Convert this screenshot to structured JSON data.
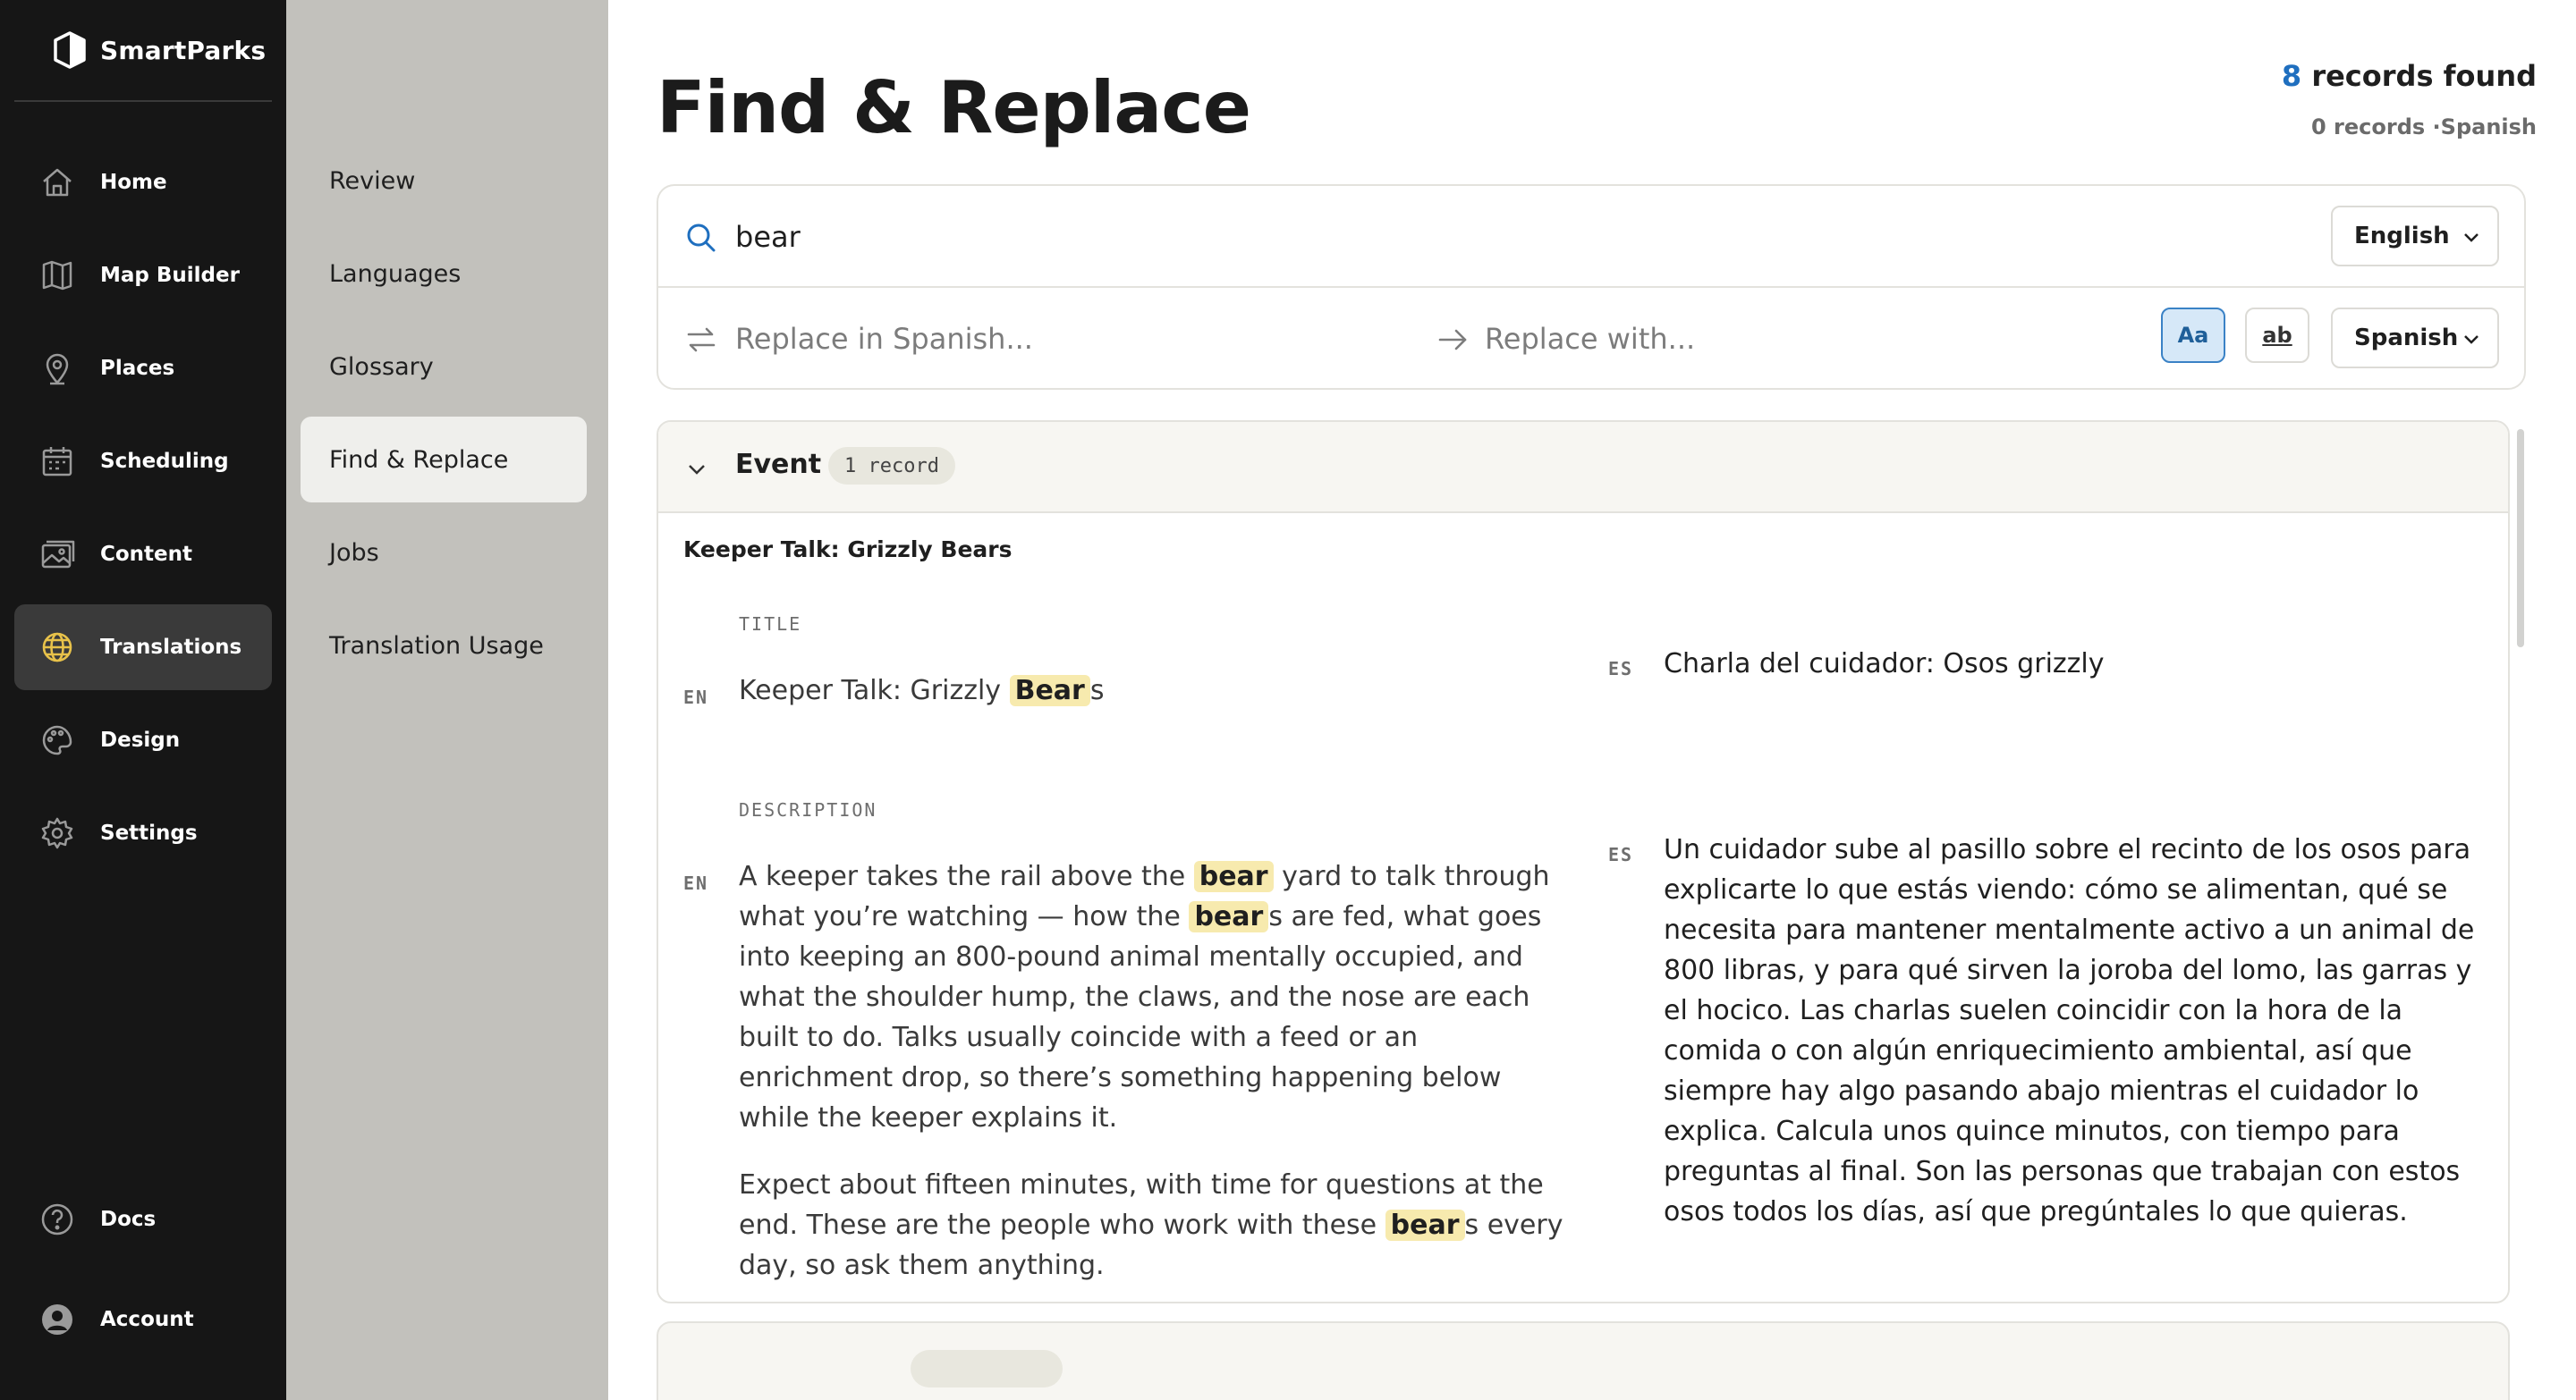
{
  "brand": {
    "name": "SmartParks"
  },
  "sidebar": {
    "items": [
      {
        "label": "Home",
        "icon": "home-icon"
      },
      {
        "label": "Map Builder",
        "icon": "map-icon"
      },
      {
        "label": "Places",
        "icon": "pin-icon"
      },
      {
        "label": "Scheduling",
        "icon": "calendar-icon"
      },
      {
        "label": "Content",
        "icon": "image-icon"
      },
      {
        "label": "Translations",
        "icon": "globe-icon",
        "active": true
      },
      {
        "label": "Design",
        "icon": "palette-icon"
      },
      {
        "label": "Settings",
        "icon": "gear-icon"
      }
    ],
    "bottom": [
      {
        "label": "Docs",
        "icon": "help-icon"
      },
      {
        "label": "Account",
        "icon": "user-icon"
      }
    ]
  },
  "subnav": {
    "items": [
      {
        "label": "Review"
      },
      {
        "label": "Languages"
      },
      {
        "label": "Glossary"
      },
      {
        "label": "Find & Replace",
        "active": true
      },
      {
        "label": "Jobs"
      },
      {
        "label": "Translation Usage"
      }
    ]
  },
  "page": {
    "title": "Find & Replace",
    "records_count": "8",
    "records_label": " records found",
    "records_sub": "0 records ·Spanish"
  },
  "search": {
    "value": "bear",
    "source_language": "English",
    "replace_placeholder": "Replace in Spanish...",
    "with_placeholder": "Replace with...",
    "match_case_label": "Aa",
    "whole_word_label": "ab",
    "target_language": "Spanish"
  },
  "results": [
    {
      "group": "Event",
      "badge": "1 record",
      "record_title": "Keeper Talk: Grizzly Bears",
      "title_label": "TITLE",
      "description_label": "DESCRIPTION",
      "en_tag": "EN",
      "es_tag": "ES",
      "title_en_pre": "Keeper Talk: Grizzly ",
      "title_en_match": "Bear",
      "title_en_post": "s",
      "title_es": "Charla del cuidador: Osos grizzly",
      "desc_en_1a": "A keeper takes the rail above the ",
      "desc_en_1m1": "bear",
      "desc_en_1b": " yard to talk through what you’re watching — how the ",
      "desc_en_1m2": "bear",
      "desc_en_1c": "s are fed, what goes into keeping an 800-pound animal mentally occupied, and what the shoulder hump, the claws, and the nose are each built to do. Talks usually coincide with a feed or an enrichment drop, so there’s something happening below while the keeper explains it.",
      "desc_en_2a": "Expect about fifteen minutes, with time for questions at the end. These are the people who work with these ",
      "desc_en_2m": "bear",
      "desc_en_2b": "s every day, so ask them anything.",
      "desc_es": "Un cuidador sube al pasillo sobre el recinto de los osos para explicarte lo que estás viendo: cómo se alimentan, qué se necesita para mantener mentalmente activo a un animal de 800 libras, y para qué sirven la joroba del lomo, las garras y el hocico. Las charlas suelen coincidir con la hora de la comida o con algún enriquecimiento ambiental, así que siempre hay algo pasando abajo mientras el cuidador lo explica. Calcula unos quince minutos, con tiempo para preguntas al final. Son las personas que trabajan con estos osos todos los días, así que pregúntales lo que quieras."
    }
  ],
  "colors": {
    "sidebar_bg": "#161616",
    "subnav_bg": "#c2c1bc",
    "accent": "#1f6fbf",
    "highlight": "#f7eaae"
  }
}
